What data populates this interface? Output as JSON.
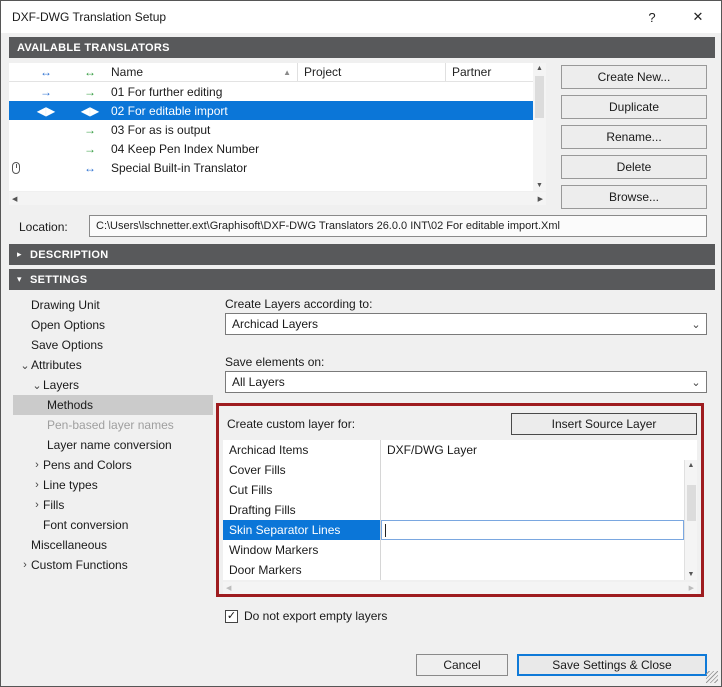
{
  "window": {
    "title": "DXF-DWG Translation Setup",
    "help": "?",
    "close": "✕"
  },
  "icons": {
    "dropdown": "⌄",
    "check": "✓",
    "scroll_up": "▲",
    "scroll_down": "▼",
    "scroll_left": "◀",
    "scroll_right": "▶"
  },
  "translators": {
    "section_title": "AVAILABLE TRANSLATORS",
    "header": {
      "open_icon": "↔",
      "save_icon": "↔",
      "name": "Name",
      "sort_icon": "▲",
      "project": "Project",
      "partner": "Partner"
    },
    "rows": [
      {
        "open": "→",
        "save": "→",
        "name": "01 For further editing",
        "project": "",
        "partner": ""
      },
      {
        "open": "◀▶",
        "save": "◀▶",
        "name": "02 For editable import",
        "project": "",
        "partner": ""
      },
      {
        "open": "",
        "save": "→",
        "name": "03 For as is output",
        "project": "",
        "partner": ""
      },
      {
        "open": "",
        "save": "→",
        "name": "04 Keep Pen Index Number",
        "project": "",
        "partner": ""
      },
      {
        "open": "",
        "save": "↔",
        "name": "Special Built-in Translator",
        "project": "",
        "partner": ""
      }
    ],
    "buttons": {
      "create_new": "Create New...",
      "duplicate": "Duplicate",
      "rename": "Rename...",
      "delete": "Delete",
      "browse": "Browse..."
    }
  },
  "location": {
    "label": "Location:",
    "path": "C:\\Users\\lschnetter.ext\\Graphisoft\\DXF-DWG Translators 26.0.0 INT\\02 For editable import.Xml"
  },
  "description_section": {
    "arrow": "▸",
    "label": "DESCRIPTION"
  },
  "settings_section": {
    "arrow": "▾",
    "label": "SETTINGS"
  },
  "tree": {
    "items": [
      {
        "chevron": "",
        "label": "Drawing Unit"
      },
      {
        "chevron": "",
        "label": "Open Options"
      },
      {
        "chevron": "",
        "label": "Save Options"
      },
      {
        "chevron": "⌄",
        "label": "Attributes"
      },
      {
        "chevron": "⌄",
        "label": "Layers"
      },
      {
        "chevron": "",
        "label": "Methods"
      },
      {
        "chevron": "",
        "label": "Pen-based layer names"
      },
      {
        "chevron": "",
        "label": "Layer name conversion"
      },
      {
        "chevron": "›",
        "label": "Pens and Colors"
      },
      {
        "chevron": "›",
        "label": "Line types"
      },
      {
        "chevron": "›",
        "label": "Fills"
      },
      {
        "chevron": "",
        "label": "Font conversion"
      },
      {
        "chevron": "",
        "label": "Miscellaneous"
      },
      {
        "chevron": "›",
        "label": "Custom Functions"
      }
    ]
  },
  "panel": {
    "create_layers_label": "Create Layers according to:",
    "create_layers_value": "Archicad Layers",
    "save_elements_label": "Save elements on:",
    "save_elements_value": "All Layers",
    "custom_layer_label": "Create custom layer for:",
    "insert_button": "Insert Source Layer",
    "table": {
      "col1": "Archicad Items",
      "col2": "DXF/DWG Layer",
      "rows": [
        "Cover Fills",
        "Cut Fills",
        "Drafting Fills",
        "Skin Separator Lines",
        "Window Markers",
        "Door Markers"
      ]
    },
    "empty_layers_checkbox": "Do not export empty layers"
  },
  "footer": {
    "cancel": "Cancel",
    "save": "Save Settings & Close"
  },
  "colors": {
    "selection": "#0b76d8",
    "annotation": "#9e1c1f",
    "section_bar": "#58595b"
  }
}
